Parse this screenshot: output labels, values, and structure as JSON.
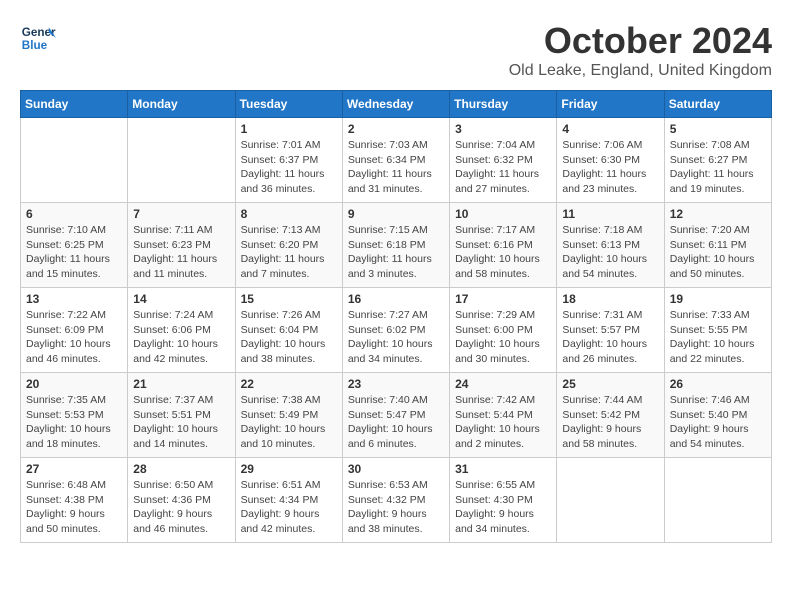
{
  "header": {
    "logo_line1": "General",
    "logo_line2": "Blue",
    "month_title": "October 2024",
    "location": "Old Leake, England, United Kingdom"
  },
  "days_of_week": [
    "Sunday",
    "Monday",
    "Tuesday",
    "Wednesday",
    "Thursday",
    "Friday",
    "Saturday"
  ],
  "weeks": [
    [
      {
        "day": "",
        "sunrise": "",
        "sunset": "",
        "daylight": ""
      },
      {
        "day": "",
        "sunrise": "",
        "sunset": "",
        "daylight": ""
      },
      {
        "day": "1",
        "sunrise": "Sunrise: 7:01 AM",
        "sunset": "Sunset: 6:37 PM",
        "daylight": "Daylight: 11 hours and 36 minutes."
      },
      {
        "day": "2",
        "sunrise": "Sunrise: 7:03 AM",
        "sunset": "Sunset: 6:34 PM",
        "daylight": "Daylight: 11 hours and 31 minutes."
      },
      {
        "day": "3",
        "sunrise": "Sunrise: 7:04 AM",
        "sunset": "Sunset: 6:32 PM",
        "daylight": "Daylight: 11 hours and 27 minutes."
      },
      {
        "day": "4",
        "sunrise": "Sunrise: 7:06 AM",
        "sunset": "Sunset: 6:30 PM",
        "daylight": "Daylight: 11 hours and 23 minutes."
      },
      {
        "day": "5",
        "sunrise": "Sunrise: 7:08 AM",
        "sunset": "Sunset: 6:27 PM",
        "daylight": "Daylight: 11 hours and 19 minutes."
      }
    ],
    [
      {
        "day": "6",
        "sunrise": "Sunrise: 7:10 AM",
        "sunset": "Sunset: 6:25 PM",
        "daylight": "Daylight: 11 hours and 15 minutes."
      },
      {
        "day": "7",
        "sunrise": "Sunrise: 7:11 AM",
        "sunset": "Sunset: 6:23 PM",
        "daylight": "Daylight: 11 hours and 11 minutes."
      },
      {
        "day": "8",
        "sunrise": "Sunrise: 7:13 AM",
        "sunset": "Sunset: 6:20 PM",
        "daylight": "Daylight: 11 hours and 7 minutes."
      },
      {
        "day": "9",
        "sunrise": "Sunrise: 7:15 AM",
        "sunset": "Sunset: 6:18 PM",
        "daylight": "Daylight: 11 hours and 3 minutes."
      },
      {
        "day": "10",
        "sunrise": "Sunrise: 7:17 AM",
        "sunset": "Sunset: 6:16 PM",
        "daylight": "Daylight: 10 hours and 58 minutes."
      },
      {
        "day": "11",
        "sunrise": "Sunrise: 7:18 AM",
        "sunset": "Sunset: 6:13 PM",
        "daylight": "Daylight: 10 hours and 54 minutes."
      },
      {
        "day": "12",
        "sunrise": "Sunrise: 7:20 AM",
        "sunset": "Sunset: 6:11 PM",
        "daylight": "Daylight: 10 hours and 50 minutes."
      }
    ],
    [
      {
        "day": "13",
        "sunrise": "Sunrise: 7:22 AM",
        "sunset": "Sunset: 6:09 PM",
        "daylight": "Daylight: 10 hours and 46 minutes."
      },
      {
        "day": "14",
        "sunrise": "Sunrise: 7:24 AM",
        "sunset": "Sunset: 6:06 PM",
        "daylight": "Daylight: 10 hours and 42 minutes."
      },
      {
        "day": "15",
        "sunrise": "Sunrise: 7:26 AM",
        "sunset": "Sunset: 6:04 PM",
        "daylight": "Daylight: 10 hours and 38 minutes."
      },
      {
        "day": "16",
        "sunrise": "Sunrise: 7:27 AM",
        "sunset": "Sunset: 6:02 PM",
        "daylight": "Daylight: 10 hours and 34 minutes."
      },
      {
        "day": "17",
        "sunrise": "Sunrise: 7:29 AM",
        "sunset": "Sunset: 6:00 PM",
        "daylight": "Daylight: 10 hours and 30 minutes."
      },
      {
        "day": "18",
        "sunrise": "Sunrise: 7:31 AM",
        "sunset": "Sunset: 5:57 PM",
        "daylight": "Daylight: 10 hours and 26 minutes."
      },
      {
        "day": "19",
        "sunrise": "Sunrise: 7:33 AM",
        "sunset": "Sunset: 5:55 PM",
        "daylight": "Daylight: 10 hours and 22 minutes."
      }
    ],
    [
      {
        "day": "20",
        "sunrise": "Sunrise: 7:35 AM",
        "sunset": "Sunset: 5:53 PM",
        "daylight": "Daylight: 10 hours and 18 minutes."
      },
      {
        "day": "21",
        "sunrise": "Sunrise: 7:37 AM",
        "sunset": "Sunset: 5:51 PM",
        "daylight": "Daylight: 10 hours and 14 minutes."
      },
      {
        "day": "22",
        "sunrise": "Sunrise: 7:38 AM",
        "sunset": "Sunset: 5:49 PM",
        "daylight": "Daylight: 10 hours and 10 minutes."
      },
      {
        "day": "23",
        "sunrise": "Sunrise: 7:40 AM",
        "sunset": "Sunset: 5:47 PM",
        "daylight": "Daylight: 10 hours and 6 minutes."
      },
      {
        "day": "24",
        "sunrise": "Sunrise: 7:42 AM",
        "sunset": "Sunset: 5:44 PM",
        "daylight": "Daylight: 10 hours and 2 minutes."
      },
      {
        "day": "25",
        "sunrise": "Sunrise: 7:44 AM",
        "sunset": "Sunset: 5:42 PM",
        "daylight": "Daylight: 9 hours and 58 minutes."
      },
      {
        "day": "26",
        "sunrise": "Sunrise: 7:46 AM",
        "sunset": "Sunset: 5:40 PM",
        "daylight": "Daylight: 9 hours and 54 minutes."
      }
    ],
    [
      {
        "day": "27",
        "sunrise": "Sunrise: 6:48 AM",
        "sunset": "Sunset: 4:38 PM",
        "daylight": "Daylight: 9 hours and 50 minutes."
      },
      {
        "day": "28",
        "sunrise": "Sunrise: 6:50 AM",
        "sunset": "Sunset: 4:36 PM",
        "daylight": "Daylight: 9 hours and 46 minutes."
      },
      {
        "day": "29",
        "sunrise": "Sunrise: 6:51 AM",
        "sunset": "Sunset: 4:34 PM",
        "daylight": "Daylight: 9 hours and 42 minutes."
      },
      {
        "day": "30",
        "sunrise": "Sunrise: 6:53 AM",
        "sunset": "Sunset: 4:32 PM",
        "daylight": "Daylight: 9 hours and 38 minutes."
      },
      {
        "day": "31",
        "sunrise": "Sunrise: 6:55 AM",
        "sunset": "Sunset: 4:30 PM",
        "daylight": "Daylight: 9 hours and 34 minutes."
      },
      {
        "day": "",
        "sunrise": "",
        "sunset": "",
        "daylight": ""
      },
      {
        "day": "",
        "sunrise": "",
        "sunset": "",
        "daylight": ""
      }
    ]
  ]
}
